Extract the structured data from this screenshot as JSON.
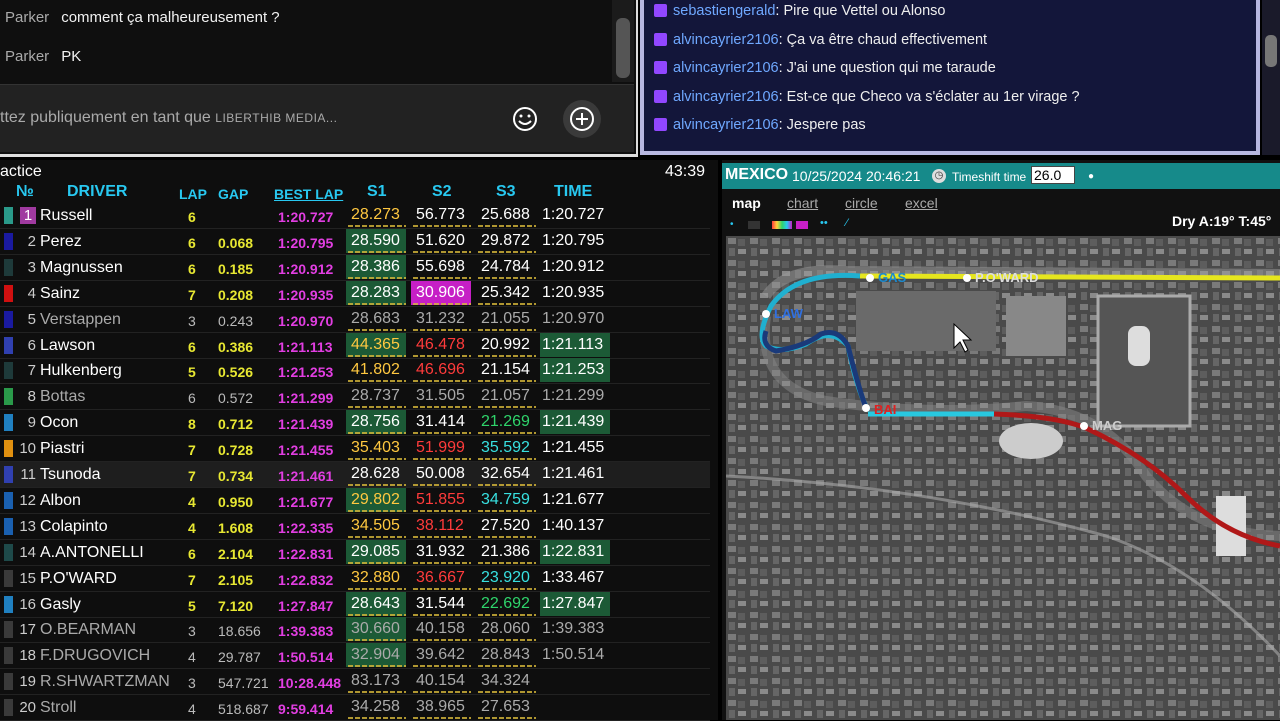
{
  "youtube_chat": {
    "messages": [
      {
        "author": "Parker",
        "text": "comment ça malheureusement ?"
      },
      {
        "author": "Parker",
        "text": "PK"
      }
    ],
    "input_placeholder": "ttez publiquement en tant que",
    "input_channel": "LIBERTHIB MEDIA...",
    "emoji_icon": "smiley-icon",
    "add_icon": "plus-circle-icon"
  },
  "twitch_chat": {
    "messages": [
      {
        "user": "sebastiengerald",
        "text": "Pire que Vettel ou Alonso"
      },
      {
        "user": "alvincayrier2106",
        "text": "Ça va être chaud effectivement"
      },
      {
        "user": "alvincayrier2106",
        "text": "J'ai une question qui me taraude"
      },
      {
        "user": "alvincayrier2106",
        "text": "Est-ce que Checo va s'éclater au 1er virage ?"
      },
      {
        "user": "alvincayrier2106",
        "text": "Jespere pas"
      }
    ]
  },
  "timing": {
    "session": "actice",
    "clock": "43:39",
    "headers": {
      "no": "№",
      "driver": "DRIVER",
      "lap": "LAP",
      "gap": "GAP",
      "best": "BEST LAP",
      "s1": "S1",
      "s2": "S2",
      "s3": "S3",
      "time": "TIME"
    },
    "rows": [
      {
        "pos": "1",
        "team": "#2a9a8a",
        "driver": "Russell",
        "lap": "6",
        "gap": "",
        "best": "1:20.727",
        "s1": "28.273",
        "s2": "56.773",
        "s3": "25.688",
        "time": "1:20.727"
      },
      {
        "pos": "2",
        "team": "#1a1aa0",
        "driver": "Perez",
        "lap": "6",
        "gap": "0.068",
        "best": "1:20.795",
        "s1": "28.590",
        "s2": "51.620",
        "s3": "29.872",
        "time": "1:20.795"
      },
      {
        "pos": "3",
        "team": "#1e3a3a",
        "driver": "Magnussen",
        "lap": "6",
        "gap": "0.185",
        "best": "1:20.912",
        "s1": "28.386",
        "s2": "55.698",
        "s3": "24.784",
        "time": "1:20.912"
      },
      {
        "pos": "4",
        "team": "#d01010",
        "driver": "Sainz",
        "lap": "7",
        "gap": "0.208",
        "best": "1:20.935",
        "s1": "28.283",
        "s2": "30.906",
        "s3": "25.342",
        "time": "1:20.935"
      },
      {
        "pos": "5",
        "team": "#1a1aa0",
        "driver": "Verstappen",
        "lap": "3",
        "gap": "0.243",
        "best": "1:20.970",
        "s1": "28.683",
        "s2": "31.232",
        "s3": "21.055",
        "time": "1:20.970"
      },
      {
        "pos": "6",
        "team": "#3040b0",
        "driver": "Lawson",
        "lap": "6",
        "gap": "0.386",
        "best": "1:21.113",
        "s1": "44.365",
        "s2": "46.478",
        "s3": "20.992",
        "time": "1:21.113"
      },
      {
        "pos": "7",
        "team": "#1e3a3a",
        "driver": "Hulkenberg",
        "lap": "5",
        "gap": "0.526",
        "best": "1:21.253",
        "s1": "41.802",
        "s2": "46.696",
        "s3": "21.154",
        "time": "1:21.253"
      },
      {
        "pos": "8",
        "team": "#2a9a4a",
        "driver": "Bottas",
        "lap": "6",
        "gap": "0.572",
        "best": "1:21.299",
        "s1": "28.737",
        "s2": "31.505",
        "s3": "21.057",
        "time": "1:21.299"
      },
      {
        "pos": "9",
        "team": "#2080c0",
        "driver": "Ocon",
        "lap": "8",
        "gap": "0.712",
        "best": "1:21.439",
        "s1": "28.756",
        "s2": "31.414",
        "s3": "21.269",
        "time": "1:21.439"
      },
      {
        "pos": "10",
        "team": "#e09010",
        "driver": "Piastri",
        "lap": "7",
        "gap": "0.728",
        "best": "1:21.455",
        "s1": "35.403",
        "s2": "51.999",
        "s3": "35.592",
        "time": "1:21.455"
      },
      {
        "pos": "11",
        "team": "#3040b0",
        "driver": "Tsunoda",
        "lap": "7",
        "gap": "0.734",
        "best": "1:21.461",
        "s1": "28.628",
        "s2": "50.008",
        "s3": "32.654",
        "time": "1:21.461"
      },
      {
        "pos": "12",
        "team": "#1a60b0",
        "driver": "Albon",
        "lap": "4",
        "gap": "0.950",
        "best": "1:21.677",
        "s1": "29.802",
        "s2": "51.855",
        "s3": "34.759",
        "time": "1:21.677"
      },
      {
        "pos": "13",
        "team": "#1a60b0",
        "driver": "Colapinto",
        "lap": "4",
        "gap": "1.608",
        "best": "1:22.335",
        "s1": "34.505",
        "s2": "38.112",
        "s3": "27.520",
        "time": "1:40.137"
      },
      {
        "pos": "14",
        "team": "#1e4a4a",
        "driver": "A.ANTONELLI",
        "lap": "6",
        "gap": "2.104",
        "best": "1:22.831",
        "s1": "29.085",
        "s2": "31.932",
        "s3": "21.386",
        "time": "1:22.831"
      },
      {
        "pos": "15",
        "team": "#3a3a3a",
        "driver": "P.O'WARD",
        "lap": "7",
        "gap": "2.105",
        "best": "1:22.832",
        "s1": "32.880",
        "s2": "36.667",
        "s3": "23.920",
        "time": "1:33.467"
      },
      {
        "pos": "16",
        "team": "#2080c0",
        "driver": "Gasly",
        "lap": "5",
        "gap": "7.120",
        "best": "1:27.847",
        "s1": "28.643",
        "s2": "31.544",
        "s3": "22.692",
        "time": "1:27.847"
      },
      {
        "pos": "17",
        "team": "#3a3a3a",
        "driver": "O.BEARMAN",
        "lap": "3",
        "gap": "18.656",
        "best": "1:39.383",
        "s1": "30.660",
        "s2": "40.158",
        "s3": "28.060",
        "time": "1:39.383"
      },
      {
        "pos": "18",
        "team": "#3a3a3a",
        "driver": "F.DRUGOVICH",
        "lap": "4",
        "gap": "29.787",
        "best": "1:50.514",
        "s1": "32.904",
        "s2": "39.642",
        "s3": "28.843",
        "time": "1:50.514"
      },
      {
        "pos": "19",
        "team": "#3a3a3a",
        "driver": "R.SHWARTZMAN",
        "lap": "3",
        "gap": "547.721",
        "best": "10:28.448",
        "s1": "83.173",
        "s2": "40.154",
        "s3": "34.324",
        "time": ""
      },
      {
        "pos": "20",
        "team": "#3a3a3a",
        "driver": "Stroll",
        "lap": "4",
        "gap": "518.687",
        "best": "9:59.414",
        "s1": "34.258",
        "s2": "38.965",
        "s3": "27.653",
        "time": ""
      }
    ]
  },
  "map_panel": {
    "location": "MEXICO",
    "datetime": "10/25/2024 20:46:21",
    "timeshift_label": "Timeshift time",
    "timeshift_value": "26.0",
    "tabs": [
      "map",
      "chart",
      "circle",
      "excel"
    ],
    "active_tab": "map",
    "weather": "Dry A:19° T:45°",
    "car_labels": [
      "GAS",
      "P.O'WARD",
      "LAW",
      "BAI",
      "MAG"
    ]
  }
}
